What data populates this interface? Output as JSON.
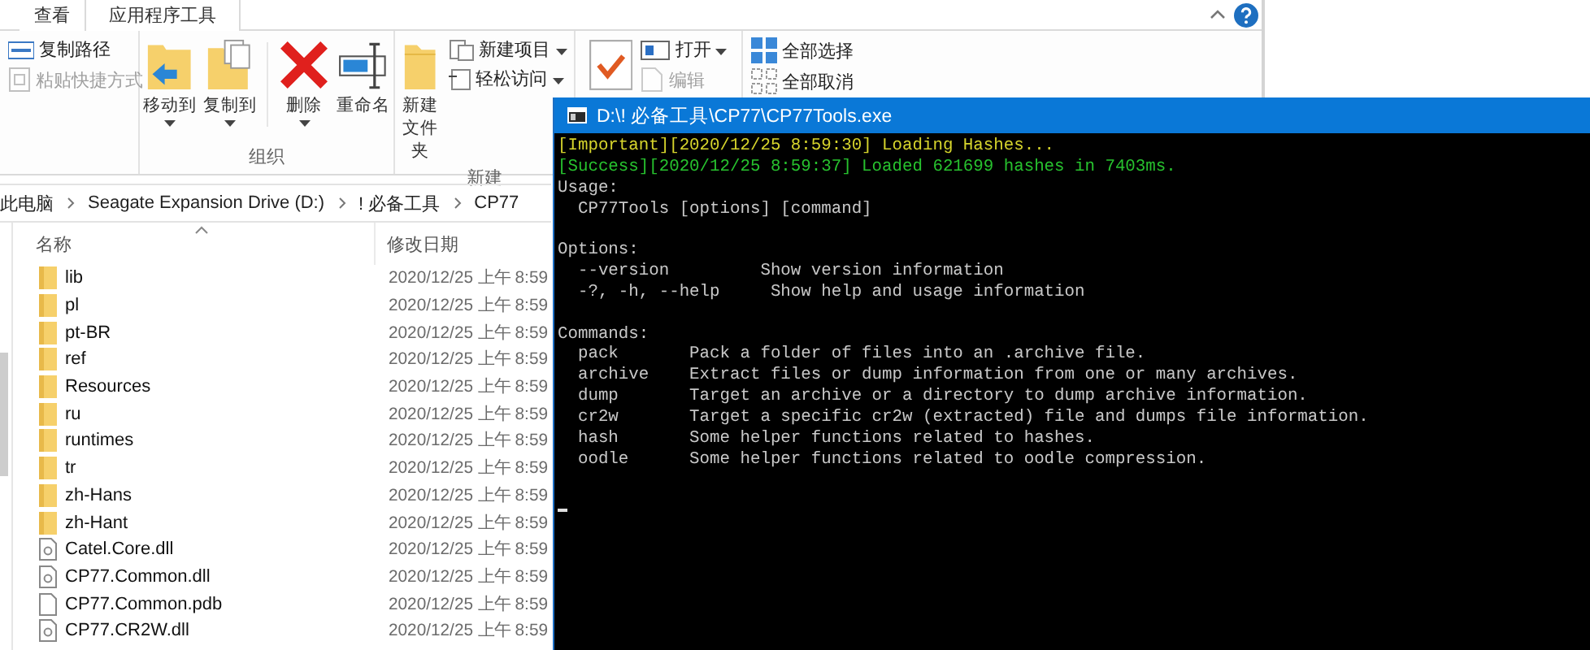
{
  "explorer": {
    "tabs": [
      {
        "label": "查看",
        "selected": false
      },
      {
        "label": "应用程序工具",
        "selected": true
      }
    ],
    "ribbon_groups": [
      {
        "items": [
          {
            "kind": "stack",
            "buttons": [
              {
                "label": "复制路径",
                "dropdown": false,
                "disabled": false
              },
              {
                "label": "粘贴快捷方式",
                "dropdown": false,
                "disabled": true
              }
            ]
          }
        ]
      },
      {
        "label": "组织",
        "items": [
          {
            "kind": "large",
            "label": "移动到",
            "dropdown": true
          },
          {
            "kind": "large",
            "label": "复制到",
            "dropdown": true
          },
          {
            "kind": "divider"
          },
          {
            "kind": "large",
            "label": "删除",
            "dropdown": true
          },
          {
            "kind": "large",
            "label": "重命名",
            "dropdown": false
          }
        ]
      },
      {
        "label": "新建",
        "items": [
          {
            "kind": "large",
            "label": "新建文件夹",
            "dropdown": false
          },
          {
            "kind": "stack",
            "buttons": [
              {
                "label": "新建项目",
                "dropdown": true,
                "disabled": false
              },
              {
                "label": "轻松访问",
                "dropdown": true,
                "disabled": false
              }
            ]
          }
        ]
      },
      {
        "items": [
          {
            "kind": "large",
            "dropdown": false
          },
          {
            "kind": "stack",
            "buttons": [
              {
                "label": "打开",
                "dropdown": true,
                "disabled": false
              },
              {
                "label": "编辑",
                "dropdown": false,
                "disabled": true
              }
            ]
          }
        ]
      },
      {
        "items": [
          {
            "kind": "stack",
            "buttons": [
              {
                "label": "全部选择",
                "dropdown": false,
                "disabled": false
              },
              {
                "label": "全部取消",
                "dropdown": false,
                "disabled": false
              }
            ]
          }
        ]
      }
    ],
    "path": [
      "此电脑",
      "Seagate Expansion Drive (D:)",
      "! 必备工具",
      "CP77"
    ],
    "columns": [
      {
        "label": "名称",
        "sorted": true
      },
      {
        "label": "修改日期",
        "sorted": false
      }
    ],
    "files": [
      {
        "name": "lib",
        "date": "2020/12/25 上午 8:59",
        "kind": "folder"
      },
      {
        "name": "pl",
        "date": "2020/12/25 上午 8:59",
        "kind": "folder"
      },
      {
        "name": "pt-BR",
        "date": "2020/12/25 上午 8:59",
        "kind": "folder"
      },
      {
        "name": "ref",
        "date": "2020/12/25 上午 8:59",
        "kind": "folder"
      },
      {
        "name": "Resources",
        "date": "2020/12/25 上午 8:59",
        "kind": "folder"
      },
      {
        "name": "ru",
        "date": "2020/12/25 上午 8:59",
        "kind": "folder"
      },
      {
        "name": "runtimes",
        "date": "2020/12/25 上午 8:59",
        "kind": "folder"
      },
      {
        "name": "tr",
        "date": "2020/12/25 上午 8:59",
        "kind": "folder"
      },
      {
        "name": "zh-Hans",
        "date": "2020/12/25 上午 8:59",
        "kind": "folder"
      },
      {
        "name": "zh-Hant",
        "date": "2020/12/25 上午 8:59",
        "kind": "folder"
      },
      {
        "name": "Catel.Core.dll",
        "date": "2020/12/25 上午 8:59",
        "kind": "library"
      },
      {
        "name": "CP77.Common.dll",
        "date": "2020/12/25 上午 8:59",
        "kind": "library"
      },
      {
        "name": "CP77.Common.pdb",
        "date": "2020/12/25 上午 8:59",
        "kind": "document"
      },
      {
        "name": "CP77.CR2W.dll",
        "date": "2020/12/25 上午 8:59",
        "kind": "library"
      }
    ]
  },
  "console": {
    "title": "D:\\! 必备工具\\CP77\\CP77Tools.exe",
    "lines": [
      {
        "kind": "important",
        "text": "[Important][2020/12/25 8:59:30] Loading Hashes..."
      },
      {
        "kind": "success",
        "text": "[Success][2020/12/25 8:59:37] Loaded 621699 hashes in 7403ms."
      },
      {
        "kind": "plain",
        "text": "Usage:"
      },
      {
        "kind": "plain",
        "text": "  CP77Tools [options] [command]"
      },
      {
        "kind": "blank"
      },
      {
        "kind": "plain",
        "text": "Options:"
      },
      {
        "kind": "plain",
        "text": "  --version         Show version information"
      },
      {
        "kind": "plain",
        "text": "  -?, -h, --help     Show help and usage information"
      },
      {
        "kind": "blank"
      },
      {
        "kind": "plain",
        "text": "Commands:"
      },
      {
        "kind": "plain",
        "text": "  pack       Pack a folder of files into an .archive file."
      },
      {
        "kind": "plain",
        "text": "  archive    Extract files or dump information from one or many archives."
      },
      {
        "kind": "plain",
        "text": "  dump       Target an archive or a directory to dump archive information."
      },
      {
        "kind": "plain",
        "text": "  cr2w       Target a specific cr2w (extracted) file and dumps file information."
      },
      {
        "kind": "plain",
        "text": "  hash       Some helper functions related to hashes."
      },
      {
        "kind": "plain",
        "text": "  oodle      Some helper functions related to oodle compression."
      },
      {
        "kind": "blank"
      },
      {
        "kind": "cursor"
      }
    ]
  }
}
